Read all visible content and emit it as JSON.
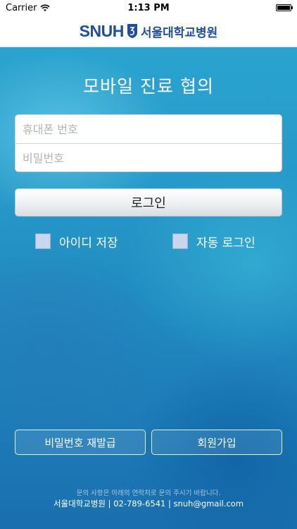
{
  "status_bar": {
    "carrier": "Carrier",
    "time": "1:13 PM",
    "battery_level": 1.0
  },
  "header": {
    "logo_en": "SNUH",
    "logo_ko": "서울대학교병원",
    "brand_color": "#1f4f9b"
  },
  "main": {
    "title": "모바일 진료 협의",
    "phone_placeholder": "휴대폰 번호",
    "password_placeholder": "비밀번호",
    "login_label": "로그인",
    "save_id_label": "아이디 저장",
    "auto_login_label": "자동 로그인"
  },
  "bottom": {
    "reset_password_label": "비밀번호 재발급",
    "signup_label": "회원가입"
  },
  "footer": {
    "note": "문의 사항은 아래의 연락처로 문의 주시기 바랍니다.",
    "contact": "서울대학교병원 | 02-789-6541 | snuh@gmail.com"
  },
  "icons": [
    "wifi-icon",
    "battery-icon",
    "snuh-emblem-icon"
  ]
}
